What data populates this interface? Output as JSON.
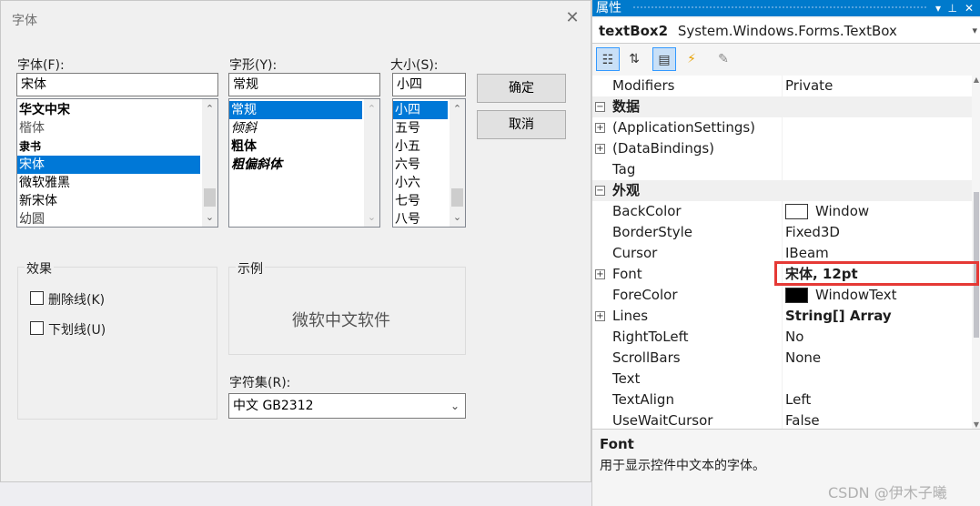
{
  "dialog": {
    "title": "字体",
    "font_label": "字体(F):",
    "font_value": "宋体",
    "font_list": [
      "华文中宋",
      "楷体",
      "隶书",
      "宋体",
      "微软雅黑",
      "新宋体",
      "幼圆"
    ],
    "font_selected_index": 3,
    "style_label": "字形(Y):",
    "style_value": "常规",
    "style_list": [
      "常规",
      "倾斜",
      "粗体",
      "粗偏斜体"
    ],
    "style_selected_index": 0,
    "size_label": "大小(S):",
    "size_value": "小四",
    "size_list": [
      "小四",
      "五号",
      "小五",
      "六号",
      "小六",
      "七号",
      "八号"
    ],
    "size_selected_index": 0,
    "ok_label": "确定",
    "cancel_label": "取消",
    "effects_label": "效果",
    "strikeout_label": "删除线(K)",
    "underline_label": "下划线(U)",
    "sample_label": "示例",
    "sample_text": "微软中文软件",
    "charset_label": "字符集(R):",
    "charset_value": "中文 GB2312"
  },
  "props": {
    "title": "属性",
    "object_name": "textBox2",
    "object_type": "System.Windows.Forms.TextBox",
    "rows": [
      {
        "kind": "prop",
        "name": "Modifiers",
        "value": "Private"
      },
      {
        "kind": "cat",
        "name": "数据",
        "expander": "⊟"
      },
      {
        "kind": "prop",
        "name": "(ApplicationSettings)",
        "value": "",
        "expander": "⊞"
      },
      {
        "kind": "prop",
        "name": "(DataBindings)",
        "value": "",
        "expander": "⊞"
      },
      {
        "kind": "prop",
        "name": "Tag",
        "value": ""
      },
      {
        "kind": "cat",
        "name": "外观",
        "expander": "⊟"
      },
      {
        "kind": "prop",
        "name": "BackColor",
        "value": "Window",
        "swatch": "#ffffff"
      },
      {
        "kind": "prop",
        "name": "BorderStyle",
        "value": "Fixed3D"
      },
      {
        "kind": "prop",
        "name": "Cursor",
        "value": "IBeam"
      },
      {
        "kind": "prop",
        "name": "Font",
        "value": "宋体, 12pt",
        "expander": "⊞",
        "bold": true
      },
      {
        "kind": "prop",
        "name": "ForeColor",
        "value": "WindowText",
        "swatch": "#000000"
      },
      {
        "kind": "prop",
        "name": "Lines",
        "value": "String[] Array",
        "expander": "⊞",
        "bold": true
      },
      {
        "kind": "prop",
        "name": "RightToLeft",
        "value": "No"
      },
      {
        "kind": "prop",
        "name": "ScrollBars",
        "value": "None"
      },
      {
        "kind": "prop",
        "name": "Text",
        "value": ""
      },
      {
        "kind": "prop",
        "name": "TextAlign",
        "value": "Left"
      },
      {
        "kind": "prop",
        "name": "UseWaitCursor",
        "value": "False"
      }
    ],
    "desc_title": "Font",
    "desc_text": "用于显示控件中文本的字体。",
    "watermark": "CSDN @伊木子曦",
    "accent_color": "#007acc",
    "highlight_color": "#e53935"
  }
}
